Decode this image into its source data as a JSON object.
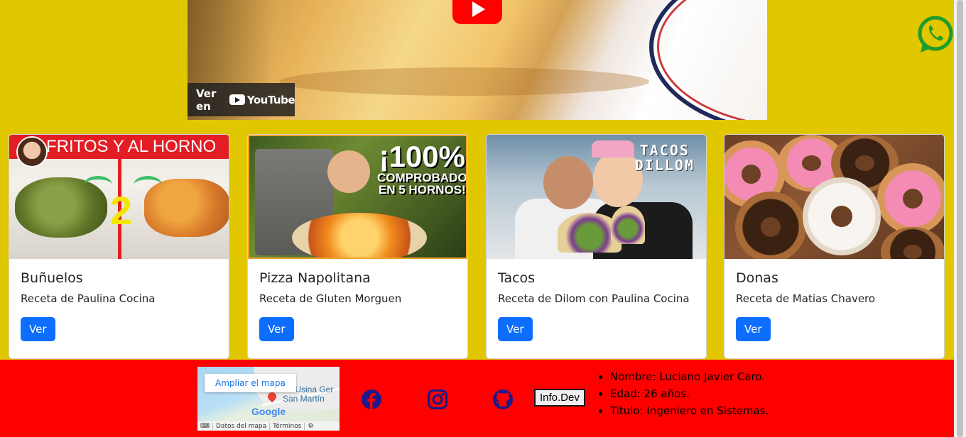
{
  "video": {
    "watch_label": "Ver en",
    "brand": "YouTube"
  },
  "cards": [
    {
      "title": "Buñuelos",
      "text": "Receta de Paulina Cocina",
      "button": "Ver",
      "thumb_text": "FRITOS Y AL HORNO",
      "thumb_number": "2"
    },
    {
      "title": "Pizza Napolitana",
      "text": "Receta de Gluten Morguen",
      "button": "Ver",
      "thumb_lines": [
        "¡100%",
        "COMPROBADO",
        "EN 5 HORNOS!"
      ]
    },
    {
      "title": "Tacos",
      "text": "Receta de Dilom con Paulina Cocina",
      "button": "Ver",
      "thumb_lines": [
        "TACOS",
        "DILLOM"
      ]
    },
    {
      "title": "Donas",
      "text": "Receta de Matias Chavero",
      "button": "Ver"
    }
  ],
  "footer": {
    "map": {
      "enlarge": "Ampliar el mapa",
      "place_line1": "Ex Usina Ger",
      "place_line2": "San Martín",
      "logo": "Google",
      "data": "Datos del mapa",
      "terms": "Términos"
    },
    "info_button": "Info.Dev",
    "info": [
      "Nombre: Luciano Javier Caro.",
      "Edad: 26 años.",
      "Titulo: Ingeniero en Sistemas."
    ]
  },
  "colors": {
    "background": "#e0c700",
    "footer": "#ff0000",
    "primary_button": "#0d6efd",
    "whatsapp": "#1f9c2b",
    "social_icons": "#1a1a8c"
  },
  "icons": [
    "youtube-play-icon",
    "whatsapp-icon",
    "facebook-icon",
    "instagram-icon",
    "github-icon"
  ]
}
